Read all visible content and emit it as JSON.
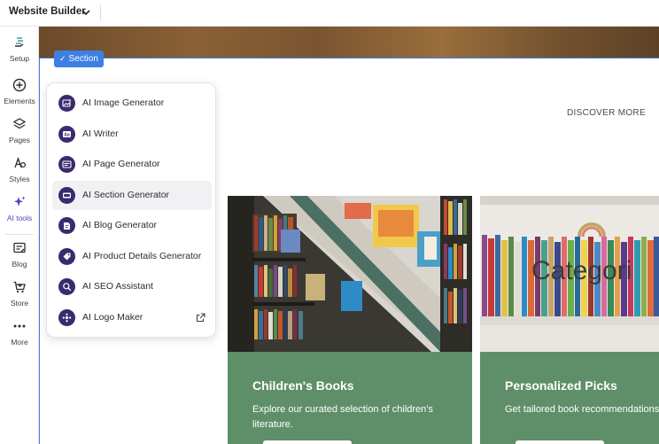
{
  "topbar": {
    "title": "Website Builder",
    "chevron_icon": "chevron-down-icon"
  },
  "rail": {
    "items": [
      {
        "label": "Setup",
        "icon": "setup-icon"
      },
      {
        "label": "Elements",
        "icon": "plus-circle-icon"
      },
      {
        "label": "Pages",
        "icon": "layers-icon"
      },
      {
        "label": "Styles",
        "icon": "styles-icon"
      },
      {
        "label": "AI tools",
        "icon": "sparkle-icon",
        "active": true
      },
      {
        "label": "Blog",
        "icon": "blog-icon"
      },
      {
        "label": "Store",
        "icon": "cart-icon"
      },
      {
        "label": "More",
        "icon": "more-icon"
      }
    ]
  },
  "canvas": {
    "section_badge": "Section",
    "discover_link": "DISCOVER MORE",
    "cards": [
      {
        "title": "Children's Books",
        "text": "Explore our curated selection of children's literature."
      },
      {
        "title": "Personalized Picks",
        "text": "Get tailored book recommendations for you.",
        "overlay": "Categori"
      }
    ]
  },
  "ai_menu": {
    "items": [
      {
        "label": "AI Image Generator",
        "icon": "image-generator-icon"
      },
      {
        "label": "AI Writer",
        "icon": "writer-icon"
      },
      {
        "label": "AI Page Generator",
        "icon": "page-generator-icon"
      },
      {
        "label": "AI Section Generator",
        "icon": "section-generator-icon",
        "highlighted": true
      },
      {
        "label": "AI Blog Generator",
        "icon": "blog-generator-icon"
      },
      {
        "label": "AI Product Details Generator",
        "icon": "product-details-icon"
      },
      {
        "label": "AI SEO Assistant",
        "icon": "seo-assistant-icon"
      },
      {
        "label": "AI Logo Maker",
        "icon": "logo-maker-icon",
        "external": true
      }
    ]
  },
  "colors": {
    "accent": "#3d7fe3",
    "ai_purple": "#5a3fc0",
    "card_green": "#5f8f68",
    "icon_dark": "#3a2a6e"
  }
}
